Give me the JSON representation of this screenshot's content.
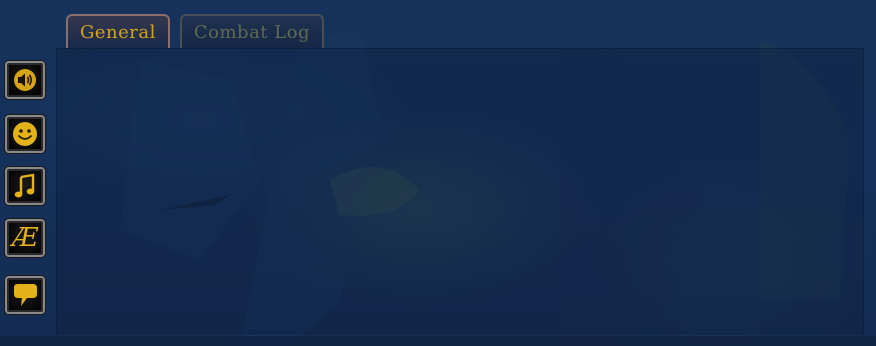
{
  "tabs": [
    {
      "label": "General",
      "active": true
    },
    {
      "label": "Combat Log",
      "active": false
    }
  ],
  "side_buttons": [
    {
      "icon": "speaker-icon"
    },
    {
      "icon": "smiley-icon"
    },
    {
      "icon": "music-note-icon"
    },
    {
      "icon": "language-ae-icon",
      "glyph": "Æ"
    },
    {
      "icon": "speech-bubble-icon"
    }
  ],
  "colors": {
    "accent_gold": "#d4a417",
    "inactive_tab_text": "#5f6a55",
    "background": "#15305a"
  }
}
